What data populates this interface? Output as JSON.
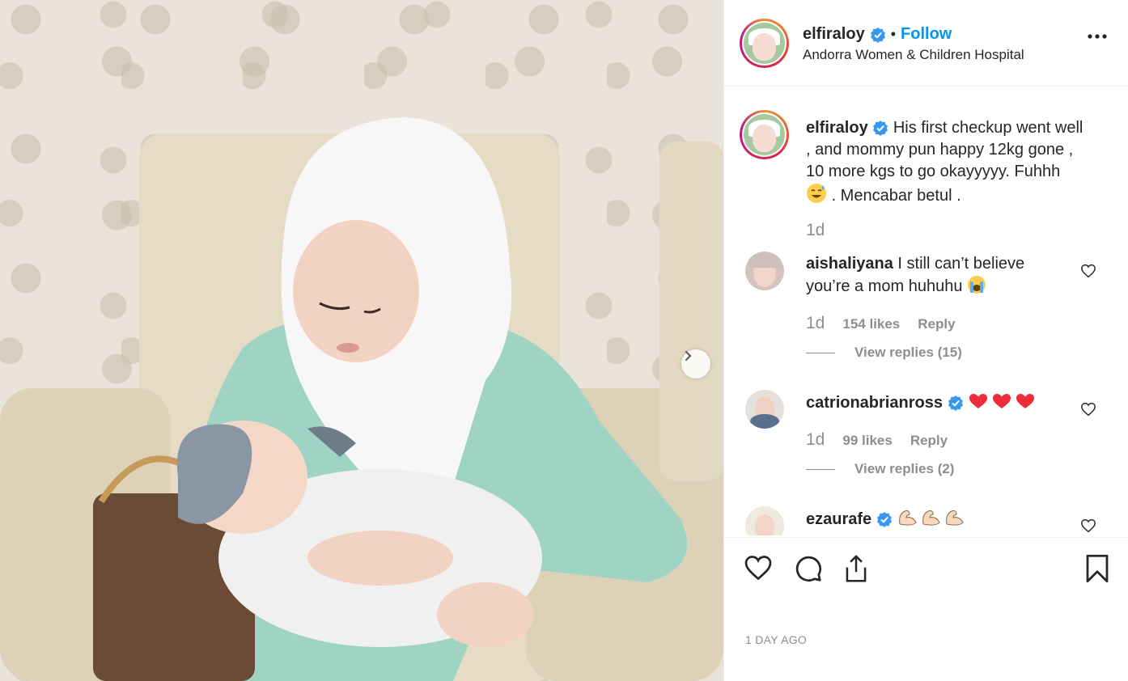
{
  "post": {
    "username": "elfiraloy",
    "follow_label": "Follow",
    "dot": "•",
    "location": "Andorra Women & Children Hospital",
    "caption_line1": "His first checkup went well",
    "caption_line2": ", and mommy pun happy 12kg gone ,",
    "caption_line3": "10 more kgs to go okayyyyy. Fuhhh",
    "caption_line4": ". Mencabar betul .",
    "caption_time": "1d",
    "date": "1 DAY AGO"
  },
  "comments": [
    {
      "username": "aishaliyana",
      "text_line1": "I still can’t believe",
      "text_line2": "you’re a mom huhuhu",
      "time": "1d",
      "likes": "154 likes",
      "reply": "Reply",
      "view_replies": "View replies (15)"
    },
    {
      "username": "catrionabrianross",
      "time": "1d",
      "likes": "99 likes",
      "reply": "Reply",
      "view_replies": "View replies (2)"
    },
    {
      "username": "ezaurafe"
    }
  ],
  "colors": {
    "accent": "#0095f6",
    "text": "#262626",
    "muted": "#8e8e8e",
    "heart_red": "#ed2b3b"
  },
  "icons": [
    "verified-badge-icon",
    "more-options-icon",
    "heart-icon",
    "comment-icon",
    "share-icon",
    "bookmark-icon",
    "next-arrow-icon"
  ]
}
